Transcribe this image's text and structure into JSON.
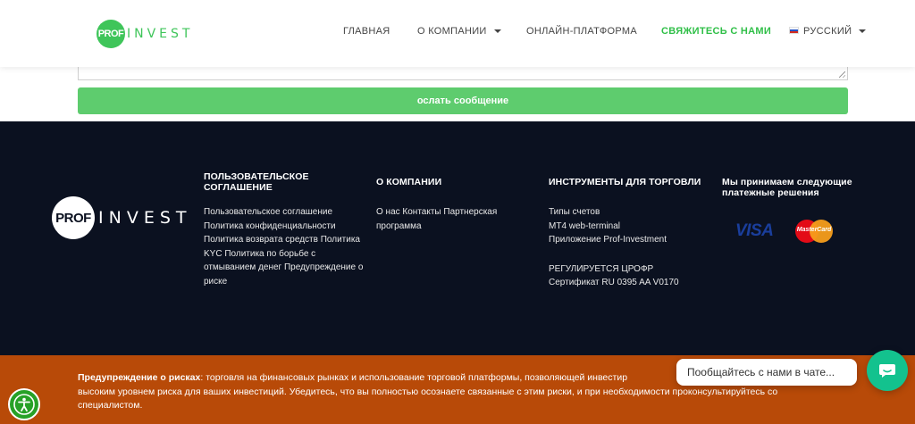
{
  "header": {
    "logo": {
      "mark": "PROF",
      "rest": "INVEST"
    },
    "nav": [
      {
        "label": "ГЛАВНАЯ"
      },
      {
        "label": "О КОМПАНИИ"
      },
      {
        "label": "ОНЛАЙН-ПЛАТФОРМА"
      },
      {
        "label": "СВЯЖИТЕСЬ С НАМИ"
      },
      {
        "label": "РУССКИЙ"
      }
    ]
  },
  "form": {
    "textarea_value": "",
    "send_label": "осл​ать сообщение"
  },
  "footer": {
    "logo": {
      "mark": "PROF",
      "rest": "INVEST"
    },
    "columns": [
      {
        "title": "ПОЛЬЗОВАТЕЛЬСКОЕ СОГЛАШЕНИЕ",
        "lines": [
          "Пользовательское соглашение",
          "Политика конфиденциальности",
          "Политика возврата средств Политика",
          "KYC Политика по борьбе с",
          "отмыванием денег Предупреждение о",
          "риске"
        ]
      },
      {
        "title": "О КОМПАНИИ",
        "lines": [
          "О нас Контакты Партнерская",
          "программа"
        ]
      },
      {
        "title": "ИНСТРУМЕНТЫ ДЛЯ ТОРГОВЛИ",
        "lines": [
          "Типы счетов",
          "MT4 web-terminal",
          "Приложение Prof-Investment",
          "",
          "РЕГУЛИРУЕТСЯ ЦРОФР",
          "Сертификат RU 0395 AA V0170"
        ]
      },
      {
        "title": "Мы принимаем следующие платежные решения",
        "lines": []
      }
    ],
    "payments": {
      "visa": "VISA",
      "mastercard": "MasterCard"
    }
  },
  "risk": {
    "title": "Предупреждение о рисках",
    "text": ": торговля на финансовых рынках и использование торговой платформы, позволяющей инвестир",
    "text2": "высоким уровнем риска для ваших инвестиций. Убедитесь, что вы полностью осознаете связанные с этим риски, и при необходимости проконсультируйтесь со",
    "text3": "специалистом."
  },
  "chat": {
    "bubble": "Пообщайтесь с нами в чате..."
  },
  "colors": {
    "accent": "#3fc55a",
    "footer_bg": "#0b1120",
    "risk_bg": "#b84a08",
    "chat": "#13c28e"
  }
}
